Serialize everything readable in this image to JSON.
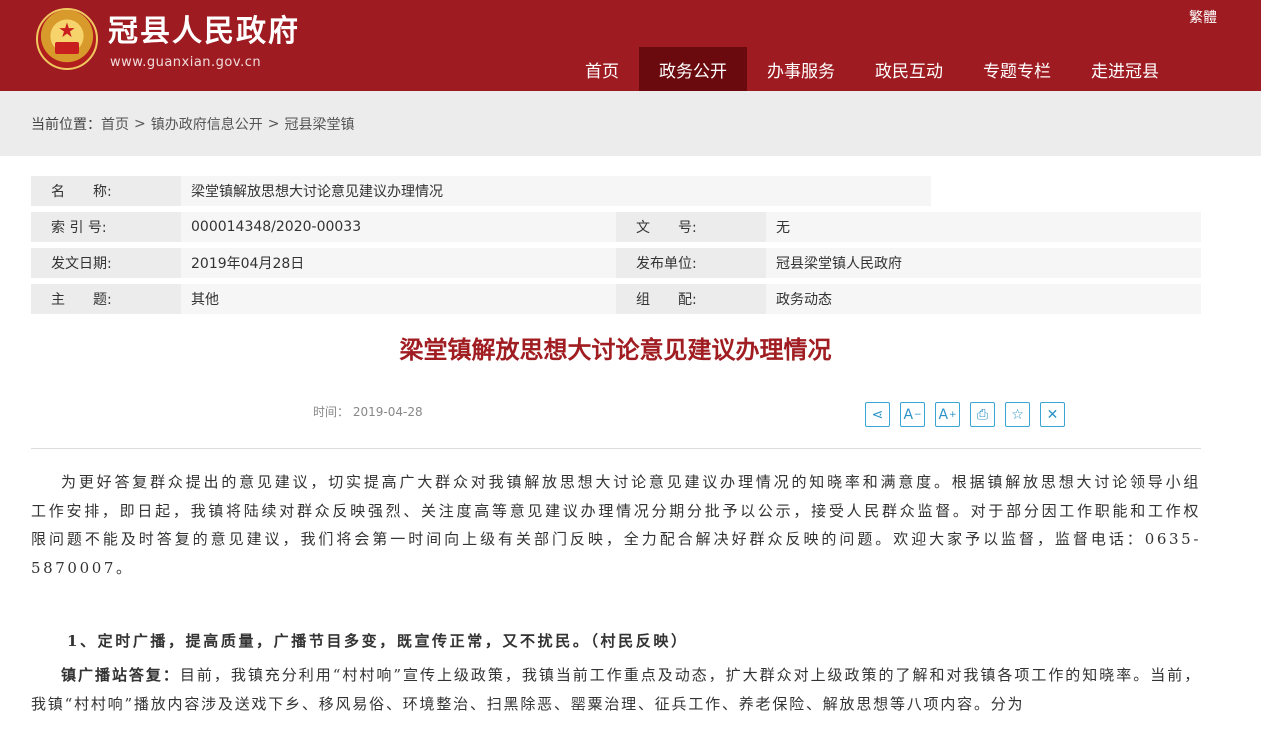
{
  "header": {
    "site_title": "冠县人民政府",
    "site_url": "www.guanxian.gov.cn",
    "lang_link": "繁體",
    "nav": [
      "首页",
      "政务公开",
      "办事服务",
      "政民互动",
      "专题专栏",
      "走进冠县"
    ],
    "active_nav": "政务公开"
  },
  "breadcrumb": {
    "prefix": "当前位置：",
    "items": [
      "首页",
      "镇办政府信息公开",
      "冠县梁堂镇"
    ],
    "separator": ">"
  },
  "info": {
    "name_label": "名　　称:",
    "name_value": "梁堂镇解放思想大讨论意见建议办理情况",
    "index_label": "索 引 号:",
    "index_value": "000014348/2020-00033",
    "docno_label": "文　　号:",
    "docno_value": "无",
    "date_label": "发文日期:",
    "date_value": "2019年04月28日",
    "publisher_label": "发布单位:",
    "publisher_value": "冠县梁堂镇人民政府",
    "topic_label": "主　　题:",
    "topic_value": "其他",
    "category_label": "组　　配:",
    "category_value": "政务动态"
  },
  "article": {
    "title": "梁堂镇解放思想大讨论意见建议办理情况",
    "time_label": "时间：",
    "time_value": "2019-04-28",
    "tools": [
      "share-icon",
      "font-decrease-icon",
      "font-increase-icon",
      "print-icon",
      "favorite-icon",
      "close-icon"
    ],
    "tool_glyphs": [
      "⋖",
      "A",
      "A",
      "⎙",
      "☆",
      "✕"
    ],
    "paragraph1": "为更好答复群众提出的意见建议，切实提高广大群众对我镇解放思想大讨论意见建议办理情况的知晓率和满意度。根据镇解放思想大讨论领导小组工作安排，即日起，我镇将陆续对群众反映强烈、关注度高等意见建议办理情况分期分批予以公示，接受人民群众监督。对于部分因工作职能和工作权限问题不能及时答复的意见建议，我们将会第一时间向上级有关部门反映，全力配合解决好群众反映的问题。欢迎大家予以监督，监督电话：0635-5870007。",
    "item1_heading": "1、定时广播，提高质量，广播节目多变，既宣传正常，又不扰民。（村民反映）",
    "item1_reply_label": "镇广播站答复：",
    "item1_reply_text": "目前，我镇充分利用“村村响”宣传上级政策，我镇当前工作重点及动态，扩大群众对上级政策的了解和对我镇各项工作的知晓率。当前，我镇“村村响”播放内容涉及送戏下乡、移风易俗、环境整治、扫黑除恶、罂粟治理、征兵工作、养老保险、解放思想等八项内容。分为"
  },
  "colors": {
    "brand_red": "#9e1b21",
    "active_nav": "#6a0a0e",
    "title_red": "#a01d22",
    "tool_blue": "#2b93c8"
  }
}
